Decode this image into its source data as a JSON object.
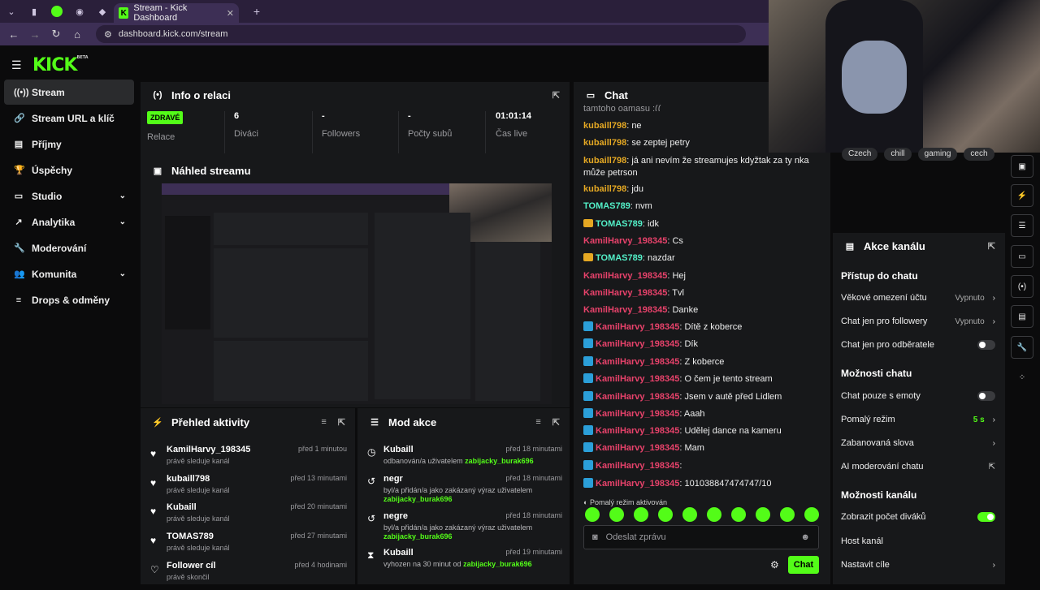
{
  "browser": {
    "tab_title": "Stream - Kick Dashboard",
    "url": "dashboard.kick.com/stream"
  },
  "brand": {
    "logo": "KICK",
    "beta": "BETA",
    "accent": "#53fc18"
  },
  "sidebar": {
    "items": [
      {
        "label": "Stream",
        "icon": "broadcast-icon"
      },
      {
        "label": "Stream URL a klíč",
        "icon": "link-icon"
      },
      {
        "label": "Příjmy",
        "icon": "wallet-icon"
      },
      {
        "label": "Úspěchy",
        "icon": "trophy-icon"
      },
      {
        "label": "Studio",
        "icon": "studio-icon"
      },
      {
        "label": "Analytika",
        "icon": "analytics-icon"
      },
      {
        "label": "Moderování",
        "icon": "wrench-icon"
      },
      {
        "label": "Komunita",
        "icon": "community-icon"
      },
      {
        "label": "Drops & odměny",
        "icon": "drops-icon"
      }
    ]
  },
  "session": {
    "title": "Info o relaci",
    "status_badge": "ZDRAVÉ",
    "status_label": "Relace",
    "viewers_value": "6",
    "viewers_label": "Diváci",
    "followers_value": "-",
    "followers_label": "Followers",
    "subs_value": "-",
    "subs_label": "Počty subů",
    "live_value": "01:01:14",
    "live_label": "Čas live"
  },
  "preview": {
    "title": "Náhled streamu"
  },
  "activity": {
    "title": "Přehled aktivity",
    "items": [
      {
        "name": "KamilHarvy_198345",
        "sub": "právě sleduje kanál",
        "time": "před 1 minutou"
      },
      {
        "name": "kubaill798",
        "sub": "právě sleduje kanál",
        "time": "před 13 minutami"
      },
      {
        "name": "Kubaill",
        "sub": "právě sleduje kanál",
        "time": "před 20 minutami"
      },
      {
        "name": "TOMAS789",
        "sub": "právě sleduje kanál",
        "time": "před 27 minutami"
      },
      {
        "name": "Follower cíl",
        "sub": "právě skončil",
        "time": "před 4 hodinami"
      }
    ]
  },
  "modactions": {
    "title": "Mod akce",
    "items": [
      {
        "name": "Kubaill",
        "text": "odbanován/a uživatelem",
        "user": "zabijacky_burak696",
        "time": "před 18 minutami"
      },
      {
        "name": "negr",
        "text": "byl/a přidán/a jako zakázaný výraz uživatelem",
        "user": "zabijacky_burak696",
        "time": "před 18 minutami"
      },
      {
        "name": "negre",
        "text": "byl/a přidán/a jako zakázaný výraz uživatelem",
        "user": "zabijacky_burak696",
        "time": "před 18 minutami"
      },
      {
        "name": "Kubaill",
        "text": "vyhozen na 30 minut od",
        "user": "zabijacky_burak696",
        "time": "před 19 minutami"
      }
    ]
  },
  "chat": {
    "title": "Chat",
    "truncated_top": "tamtoho oamasu :((",
    "messages": [
      {
        "user": "kubaill798",
        "color": "#e5a823",
        "badge": "",
        "text": ": ne"
      },
      {
        "user": "kubaill798",
        "color": "#e5a823",
        "badge": "",
        "text": ": se zeptej petry"
      },
      {
        "user": "kubaill798",
        "color": "#e5a823",
        "badge": "",
        "text": ": já ani nevím že streamujes kdyžtak za ty nka může petrson"
      },
      {
        "user": "kubaill798",
        "color": "#e5a823",
        "badge": "",
        "text": ": jdu"
      },
      {
        "user": "TOMAS789",
        "color": "#53f0c8",
        "badge": "",
        "text": ": nvm"
      },
      {
        "user": "TOMAS789",
        "color": "#53f0c8",
        "badge": "crown",
        "text": ": idk"
      },
      {
        "user": "KamilHarvy_198345",
        "color": "#e8426b",
        "badge": "",
        "text": ": Cs"
      },
      {
        "user": "TOMAS789",
        "color": "#53f0c8",
        "badge": "crown",
        "text": ": nazdar"
      },
      {
        "user": "KamilHarvy_198345",
        "color": "#e8426b",
        "badge": "",
        "text": ": Hej"
      },
      {
        "user": "KamilHarvy_198345",
        "color": "#e8426b",
        "badge": "",
        "text": ": Tvl"
      },
      {
        "user": "KamilHarvy_198345",
        "color": "#e8426b",
        "badge": "",
        "text": ": Danke"
      },
      {
        "user": "KamilHarvy_198345",
        "color": "#e8426b",
        "badge": "vip",
        "text": ": Dítě z koberce"
      },
      {
        "user": "KamilHarvy_198345",
        "color": "#e8426b",
        "badge": "vip",
        "text": ": Dík"
      },
      {
        "user": "KamilHarvy_198345",
        "color": "#e8426b",
        "badge": "vip",
        "text": ": Z koberce"
      },
      {
        "user": "KamilHarvy_198345",
        "color": "#e8426b",
        "badge": "vip",
        "text": ": O čem je tento stream"
      },
      {
        "user": "KamilHarvy_198345",
        "color": "#e8426b",
        "badge": "vip",
        "text": ": Jsem v autě před Lidlem"
      },
      {
        "user": "KamilHarvy_198345",
        "color": "#e8426b",
        "badge": "vip",
        "text": ": Aaah"
      },
      {
        "user": "KamilHarvy_198345",
        "color": "#e8426b",
        "badge": "vip",
        "text": ": Udělej dance na kameru"
      },
      {
        "user": "KamilHarvy_198345",
        "color": "#e8426b",
        "badge": "vip",
        "text": ": Mam"
      },
      {
        "user": "KamilHarvy_198345",
        "color": "#e8426b",
        "badge": "vip",
        "text": ":"
      },
      {
        "user": "KamilHarvy_198345",
        "color": "#e8426b",
        "badge": "vip",
        "text": ": 101038847474747/10"
      }
    ],
    "slowmode_note": "Pomalý režim aktivován",
    "input_placeholder": "Odeslat zprávu",
    "send_label": "Chat"
  },
  "tags": [
    "Czech",
    "chill",
    "gaming",
    "cech"
  ],
  "channel_actions": {
    "title": "Akce kanálu",
    "section_chat_access": "Přístup do chatu",
    "age": {
      "label": "Věkové omezení účtu",
      "value": "Vypnuto"
    },
    "followers_only": {
      "label": "Chat jen pro followery",
      "value": "Vypnuto"
    },
    "subs_only": {
      "label": "Chat jen pro odběratele"
    },
    "section_chat_options": "Možnosti chatu",
    "emotes_only": {
      "label": "Chat pouze s emoty"
    },
    "slow_mode": {
      "label": "Pomalý režim",
      "value": "5 s"
    },
    "banned_words": {
      "label": "Zabanovaná slova"
    },
    "ai_mod": {
      "label": "AI moderování chatu"
    },
    "section_channel_options": "Možnosti kanálu",
    "viewer_count": {
      "label": "Zobrazit počet diváků"
    },
    "host": {
      "label": "Host kanál"
    },
    "goals": {
      "label": "Nastavit cíle"
    }
  }
}
